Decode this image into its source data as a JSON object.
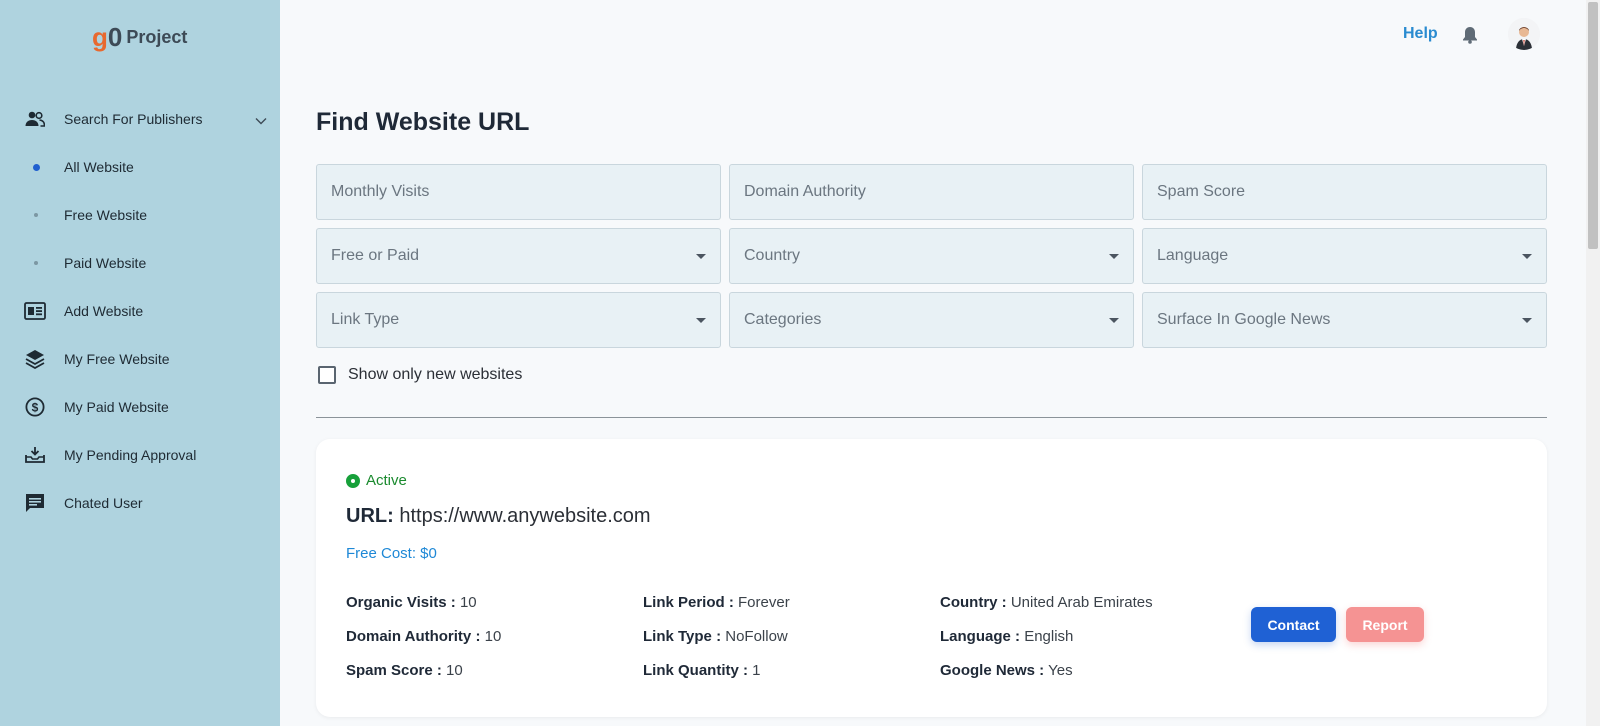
{
  "brand": {
    "logo_g": "g",
    "logo_zero": "0",
    "logo_word": "Project",
    "accent": "#e8692f"
  },
  "sidebar": {
    "items": [
      {
        "label": "Search For Publishers",
        "icon": "users-icon",
        "expandable": true
      },
      {
        "label": "All Website",
        "icon": "dot-active"
      },
      {
        "label": "Free Website",
        "icon": "dot"
      },
      {
        "label": "Paid Website",
        "icon": "dot"
      },
      {
        "label": "Add Website",
        "icon": "newspaper-icon"
      },
      {
        "label": "My Free Website",
        "icon": "layers-icon"
      },
      {
        "label": "My Paid Website",
        "icon": "dollar-circle-icon"
      },
      {
        "label": "My Pending Approval",
        "icon": "inbox-icon"
      },
      {
        "label": "Chated User",
        "icon": "chat-icon"
      }
    ]
  },
  "topbar": {
    "help": "Help",
    "bell_icon": "bell-icon",
    "avatar": "user-avatar"
  },
  "page": {
    "title": "Find Website URL",
    "filters": {
      "monthly_visits": "Monthly Visits",
      "domain_authority": "Domain Authority",
      "spam_score": "Spam Score",
      "free_or_paid": "Free or Paid",
      "country": "Country",
      "language": "Language",
      "link_type": "Link Type",
      "categories": "Categories",
      "google_news": "Surface In Google News"
    },
    "show_new_label": "Show only new websites"
  },
  "card": {
    "status": "Active",
    "url_label": "URL:",
    "url": "https://www.anywebsite.com",
    "cost": "Free Cost: $0",
    "stats": {
      "organic_visits_label": "Organic Visits :",
      "organic_visits": "10",
      "domain_authority_label": "Domain Authority :",
      "domain_authority": "10",
      "spam_score_label": "Spam Score :",
      "spam_score": "10",
      "link_period_label": "Link Period :",
      "link_period": "Forever",
      "link_type_label": "Link Type :",
      "link_type": "NoFollow",
      "link_quantity_label": "Link Quantity :",
      "link_quantity": "1",
      "country_label": "Country :",
      "country": "United Arab Emirates",
      "language_label": "Language :",
      "language": "English",
      "google_news_label": "Google News :",
      "google_news": "Yes"
    },
    "contact": "Contact",
    "report": "Report"
  },
  "colors": {
    "sidebar_bg": "#afd3df",
    "primary": "#1f61d4",
    "report": "#f59393",
    "active": "#17a03a",
    "link": "#2a8bd0"
  }
}
